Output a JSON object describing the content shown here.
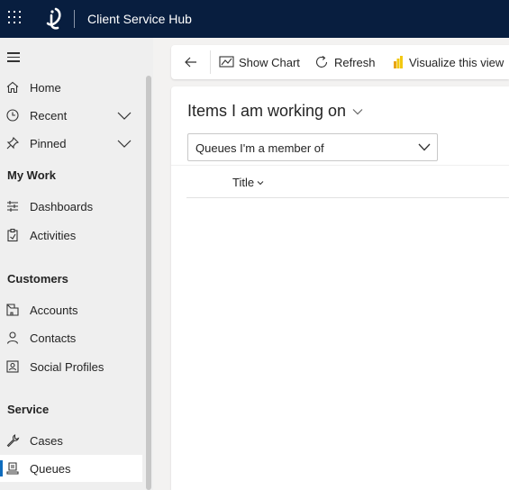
{
  "app": {
    "title": "Client Service Hub"
  },
  "sidebar": {
    "items_top": [
      {
        "label": "Home",
        "icon": "home-icon"
      },
      {
        "label": "Recent",
        "icon": "clock-icon"
      },
      {
        "label": "Pinned",
        "icon": "pin-icon"
      }
    ],
    "sections": [
      {
        "title": "My Work",
        "items": [
          {
            "label": "Dashboards",
            "icon": "dashboard-icon"
          },
          {
            "label": "Activities",
            "icon": "clipboard-icon"
          }
        ]
      },
      {
        "title": "Customers",
        "items": [
          {
            "label": "Accounts",
            "icon": "building-icon"
          },
          {
            "label": "Contacts",
            "icon": "person-icon"
          },
          {
            "label": "Social Profiles",
            "icon": "profile-card-icon"
          }
        ]
      },
      {
        "title": "Service",
        "items": [
          {
            "label": "Cases",
            "icon": "wrench-icon"
          },
          {
            "label": "Queues",
            "icon": "queue-icon",
            "active": true
          }
        ]
      }
    ]
  },
  "commandbar": {
    "show_chart": "Show Chart",
    "refresh": "Refresh",
    "visualize": "Visualize this view"
  },
  "main": {
    "view_title": "Items I am working on",
    "queue_filter": "Queues I'm a member of",
    "columns": [
      "Title"
    ]
  },
  "colors": {
    "topbar": "#081e3f",
    "accent": "#0f6cbd",
    "powerbi_yellow": "#f2c811"
  }
}
